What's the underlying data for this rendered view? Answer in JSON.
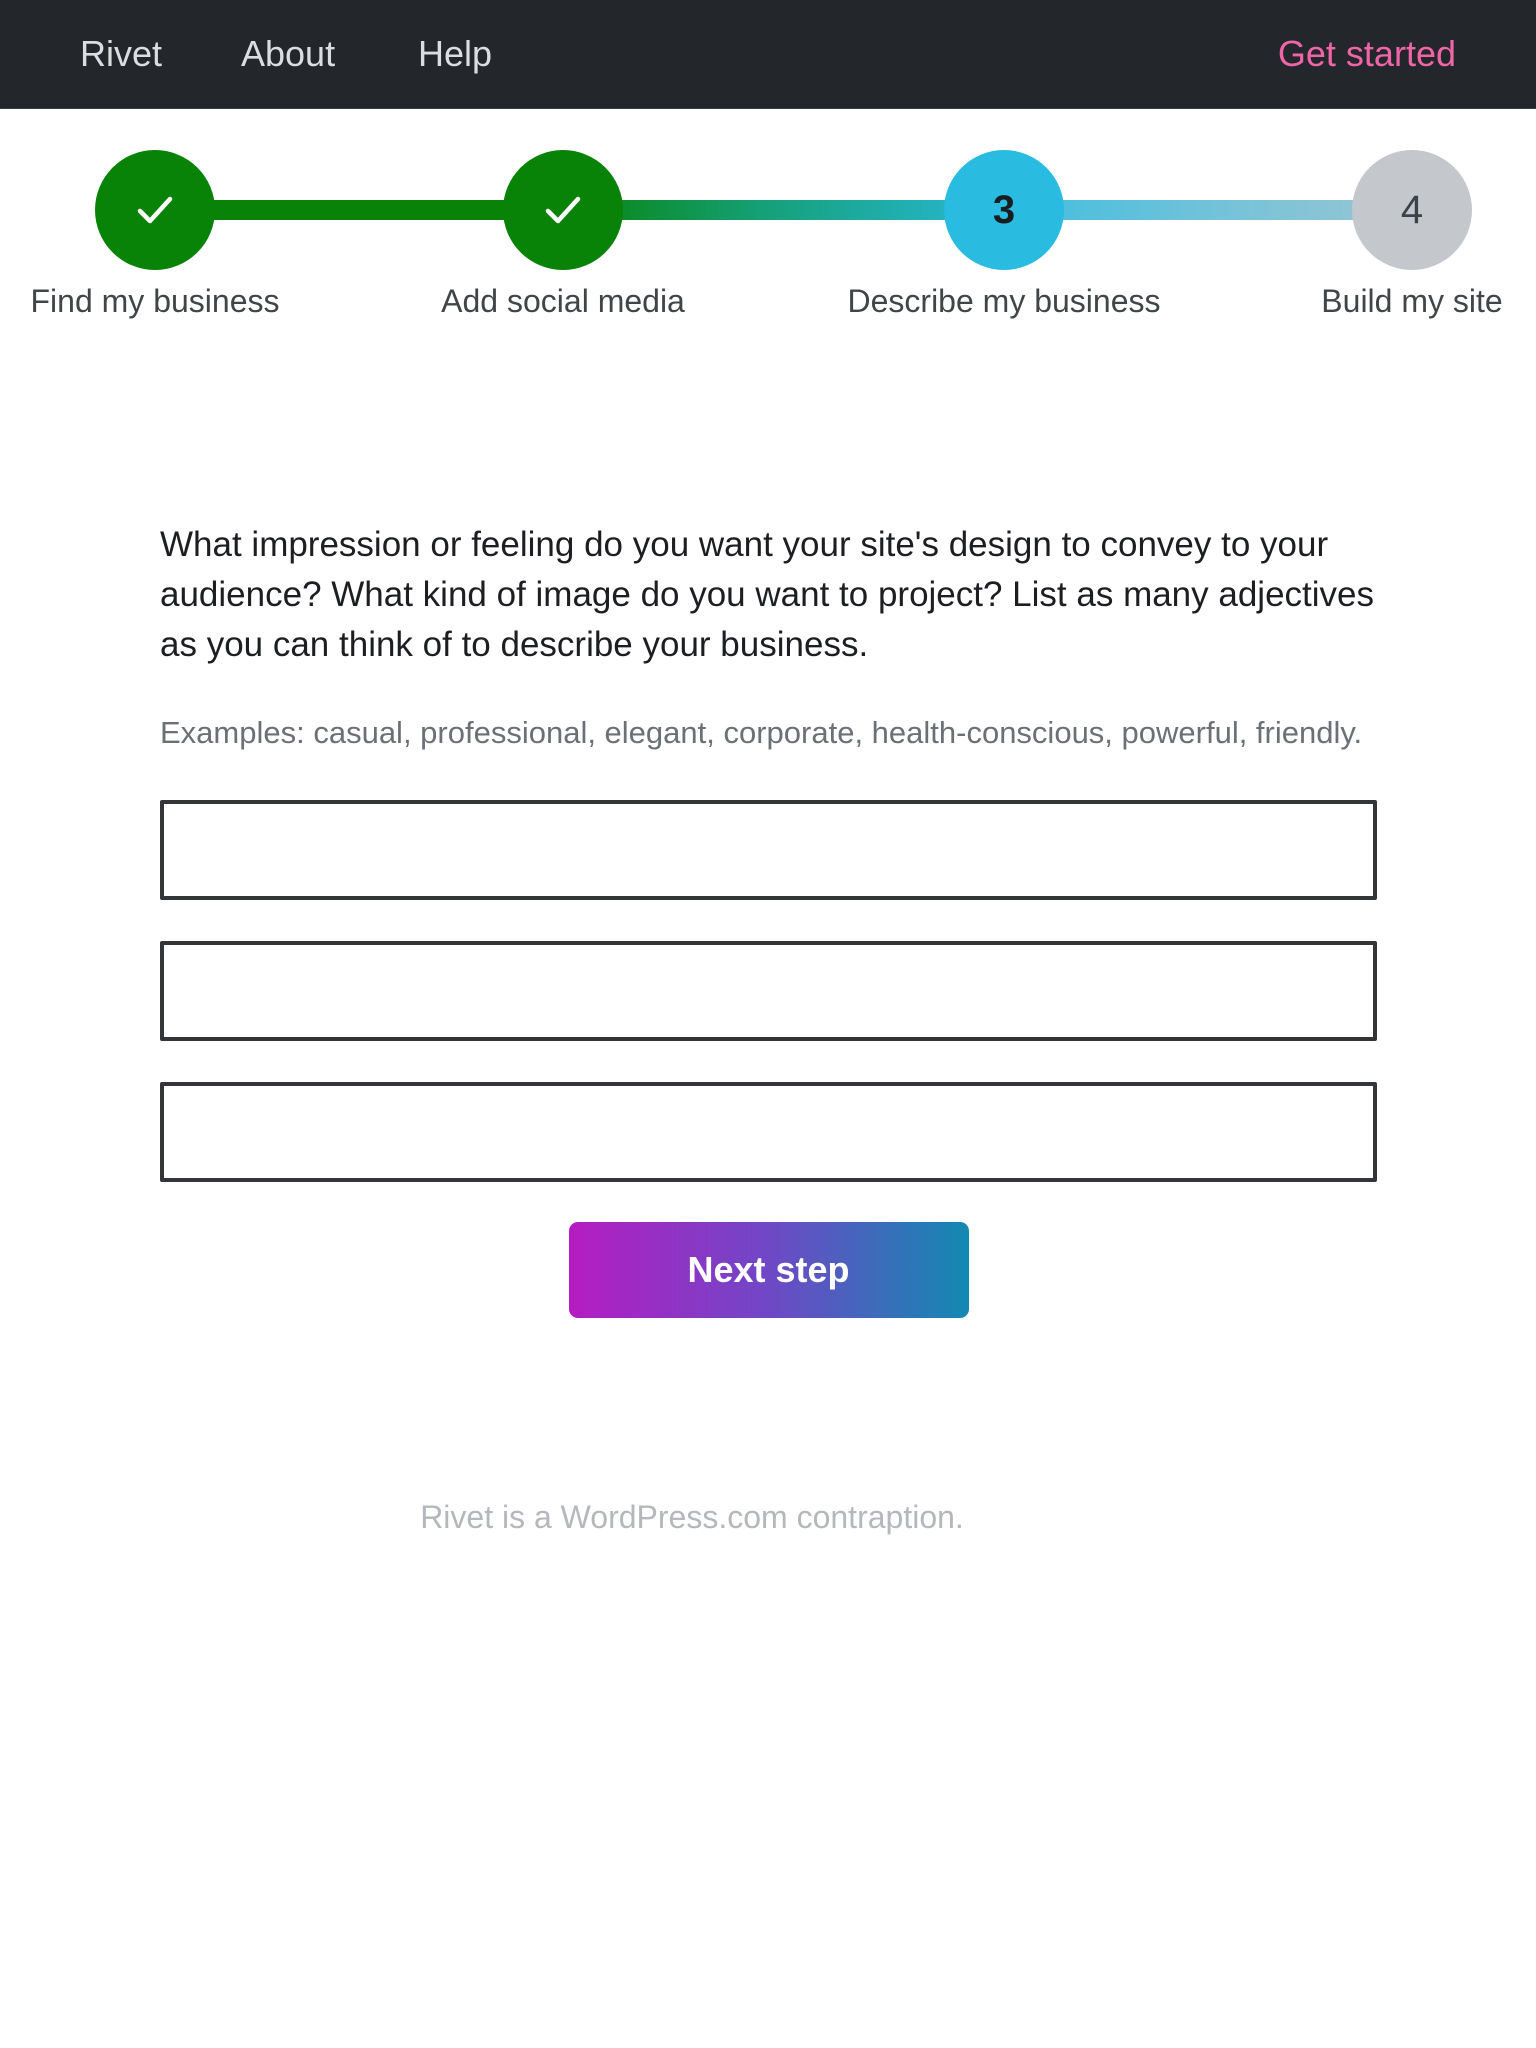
{
  "navbar": {
    "brand": "Rivet",
    "links": [
      "About",
      "Help"
    ],
    "cta": "Get started",
    "colors": {
      "background": "#23272b",
      "link": "#dcdde0",
      "cta": "#f065a8"
    }
  },
  "stepper": {
    "steps": [
      {
        "number": "1",
        "label": "Find my business",
        "status": "completed",
        "icon": "check-icon"
      },
      {
        "number": "2",
        "label": "Add social media",
        "status": "completed",
        "icon": "check-icon"
      },
      {
        "number": "3",
        "label": "Describe my business",
        "status": "current"
      },
      {
        "number": "4",
        "label": "Build my site",
        "status": "upcoming"
      }
    ],
    "colors": {
      "completed": "#088308",
      "current": "#29bbe0",
      "upcoming": "#c4c7cc"
    }
  },
  "form": {
    "question": "What impression or feeling do you want your site's design to convey to your audience? What kind of image do you want to project? List as many adjectives as you can think of to describe your business.",
    "examples": "Examples: casual, professional, elegant, corporate, health-conscious, powerful, friendly.",
    "inputs": [
      {
        "value": "",
        "placeholder": ""
      },
      {
        "value": "",
        "placeholder": ""
      },
      {
        "value": "",
        "placeholder": ""
      }
    ],
    "next_button": "Next step"
  },
  "footer": {
    "text": "Rivet is a WordPress.com contraption."
  }
}
